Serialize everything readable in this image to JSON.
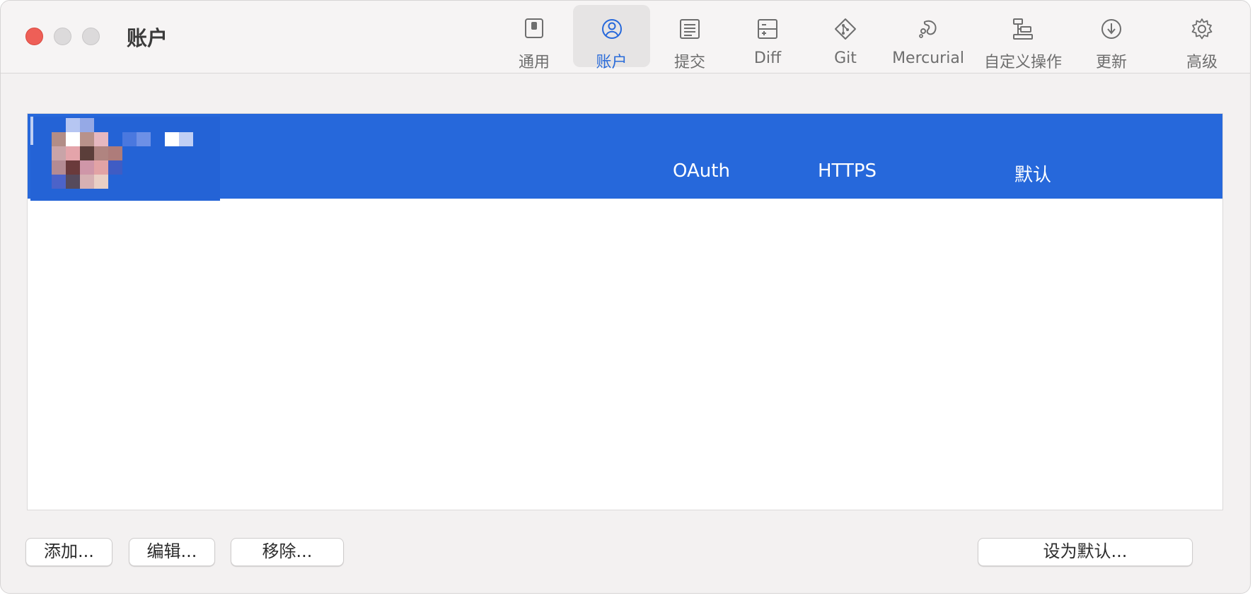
{
  "window": {
    "title": "账户"
  },
  "toolbar": {
    "items": [
      {
        "label": "通用",
        "icon": "switch-icon"
      },
      {
        "label": "账户",
        "icon": "person-circle-icon",
        "active": true
      },
      {
        "label": "提交",
        "icon": "document-lines-icon"
      },
      {
        "label": "Diff",
        "icon": "diff-icon"
      },
      {
        "label": "Git",
        "icon": "git-icon"
      },
      {
        "label": "Mercurial",
        "icon": "mercurial-icon"
      },
      {
        "label": "自定义操作",
        "icon": "flowchart-icon"
      },
      {
        "label": "更新",
        "icon": "download-circle-icon"
      },
      {
        "label": "高级",
        "icon": "gear-icon"
      }
    ]
  },
  "accounts": [
    {
      "auth": "OAuth",
      "protocol": "HTTPS",
      "status": "默认",
      "selected": true
    }
  ],
  "buttons": {
    "add": "添加...",
    "edit": "编辑...",
    "remove": "移除...",
    "set_default": "设为默认..."
  },
  "colors": {
    "accent": "#2668db",
    "close": "#ee5f57",
    "window_bg": "#f3f1f1"
  }
}
